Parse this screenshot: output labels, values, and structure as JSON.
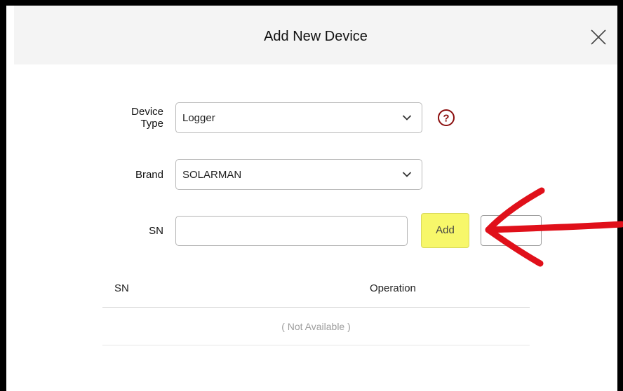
{
  "dialog": {
    "title": "Add New Device"
  },
  "form": {
    "device_type": {
      "label": "Device Type",
      "value": "Logger"
    },
    "brand": {
      "label": "Brand",
      "value": "SOLARMAN"
    },
    "sn": {
      "label": "SN",
      "value": "",
      "placeholder": ""
    },
    "add_button_label": "Add"
  },
  "table": {
    "columns": [
      "SN",
      "Operation"
    ],
    "empty_text": "( Not Available )"
  },
  "colors": {
    "add_highlight": "#f7f76a",
    "help_icon": "#8b0d0d",
    "annotation_arrow": "#e0101a"
  }
}
